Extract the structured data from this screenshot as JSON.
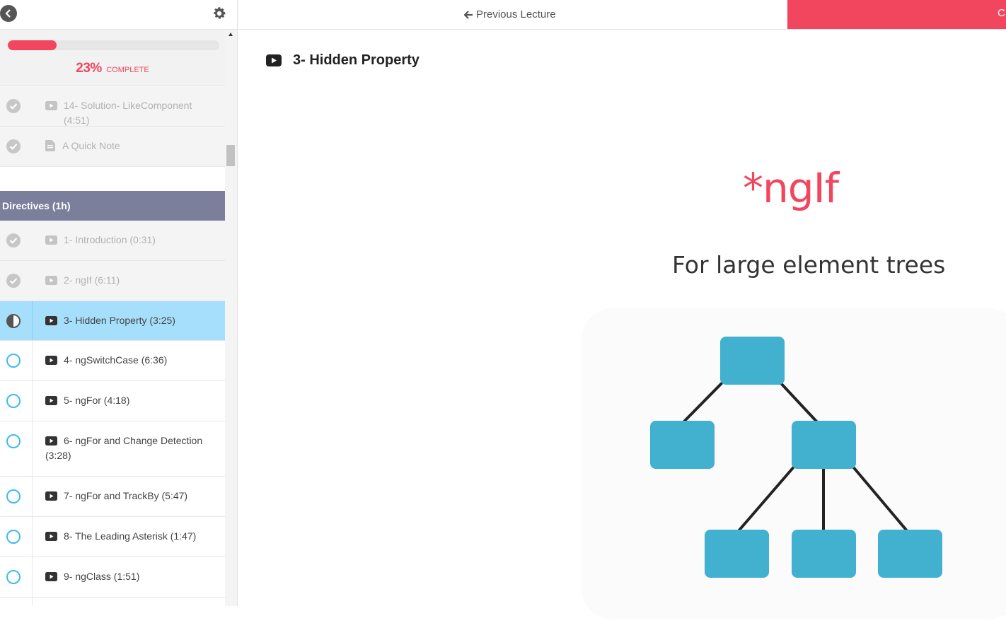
{
  "sidebar": {
    "back_icon": "chevron-left-icon",
    "settings_icon": "gear-icon",
    "progress": {
      "percent": 23,
      "percent_text": "23%",
      "label": "COMPLETE"
    },
    "prev_items": [
      {
        "type": "video",
        "title": "14- Solution- LikeComponent (4:51)",
        "status": "complete"
      },
      {
        "type": "text",
        "title": "A Quick Note",
        "status": "complete"
      }
    ],
    "section": {
      "title": "Directives (1h)"
    },
    "items": [
      {
        "type": "video",
        "title": "1- Introduction (0:31)",
        "status": "complete"
      },
      {
        "type": "video",
        "title": "2- ngIf (6:11)",
        "status": "complete"
      },
      {
        "type": "video",
        "title": "3- Hidden Property (3:25)",
        "status": "in-progress"
      },
      {
        "type": "video",
        "title": "4- ngSwitchCase (6:36)",
        "status": "incomplete"
      },
      {
        "type": "video",
        "title": "5- ngFor (4:18)",
        "status": "incomplete"
      },
      {
        "type": "video",
        "title": "6- ngFor and Change Detection (3:28)",
        "status": "incomplete"
      },
      {
        "type": "video",
        "title": "7- ngFor and TrackBy (5:47)",
        "status": "incomplete"
      },
      {
        "type": "video",
        "title": "8- The Leading Asterisk (1:47)",
        "status": "incomplete"
      },
      {
        "type": "video",
        "title": "9- ngClass (1:51)",
        "status": "incomplete"
      }
    ]
  },
  "topbar": {
    "prev_label": "Previous Lecture",
    "complete_label": "C"
  },
  "lecture": {
    "title": "3- Hidden Property",
    "slide": {
      "heading": "*ngIf",
      "subheading": "For large element trees"
    }
  },
  "colors": {
    "accent": "#f2465e",
    "section_bg": "#7c7f9c",
    "active_bg": "#a6dffb",
    "node": "#42b0cf",
    "incomplete_ring": "#3dbcec"
  }
}
